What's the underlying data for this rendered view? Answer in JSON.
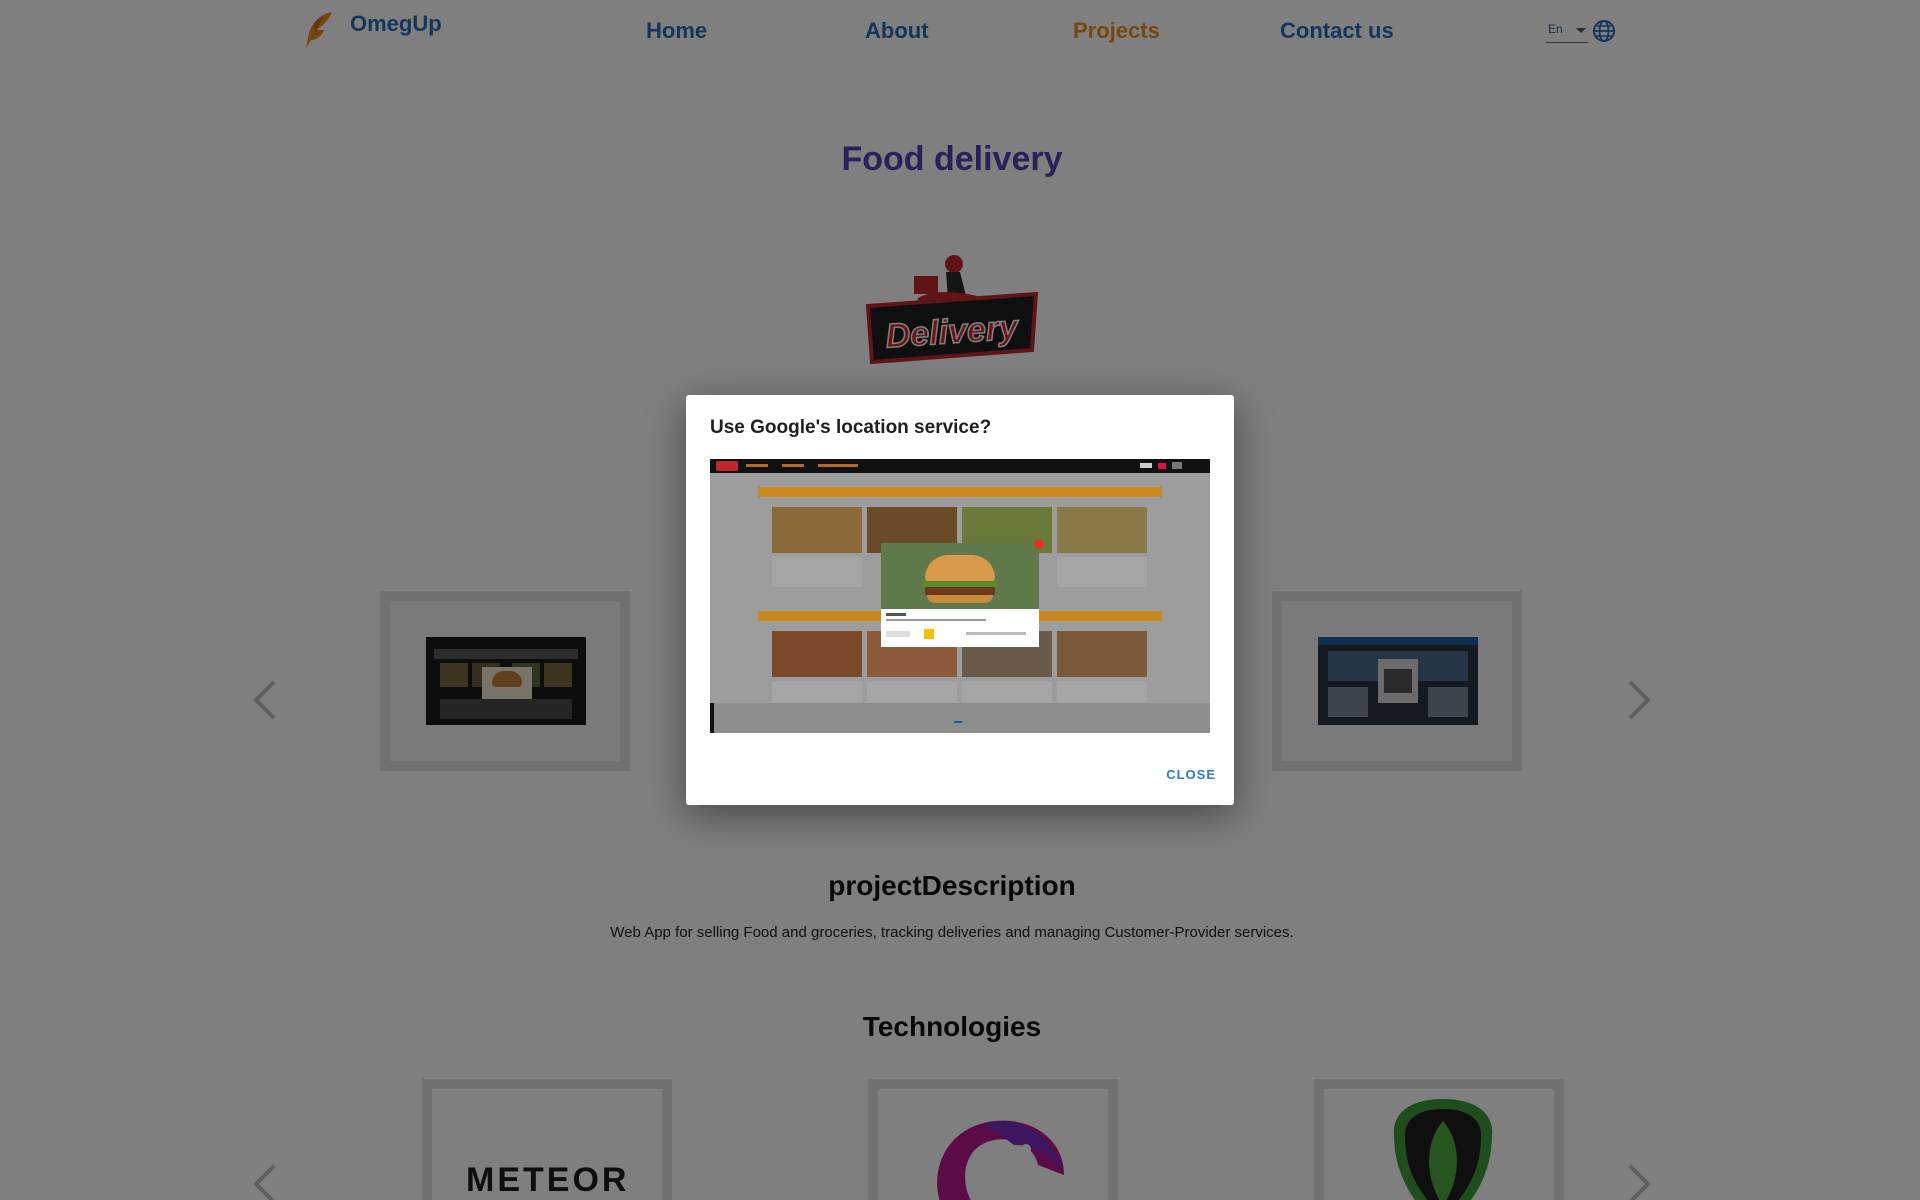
{
  "brand": {
    "name": "OmegUp",
    "icon": "quill-logo-icon"
  },
  "nav": {
    "links": [
      {
        "label": "Home",
        "active": false
      },
      {
        "label": "About",
        "active": false
      },
      {
        "label": "Projects",
        "active": true
      },
      {
        "label": "Contact us",
        "active": false
      }
    ],
    "language": {
      "value": "En",
      "icon": "globe-icon"
    }
  },
  "project": {
    "title": "Food delivery",
    "logo_text": "Delivery",
    "description_heading": "projectDescription",
    "description": "Web App for selling Food and groceries, tracking deliveries and managing Customer-Provider services.",
    "technologies_heading": "Technologies",
    "technologies": [
      {
        "text": "METEOR"
      },
      {
        "icon": "rxjs-icon"
      },
      {
        "icon": "mongodb-leaf-icon"
      }
    ]
  },
  "dialog": {
    "title": "Use Google's location service?",
    "close_label": "CLOSE"
  },
  "colors": {
    "nav_link": "#2a6bb5",
    "nav_active": "#f08a24",
    "title": "#5b3fb5",
    "dialog_button": "#2c7bd0"
  }
}
